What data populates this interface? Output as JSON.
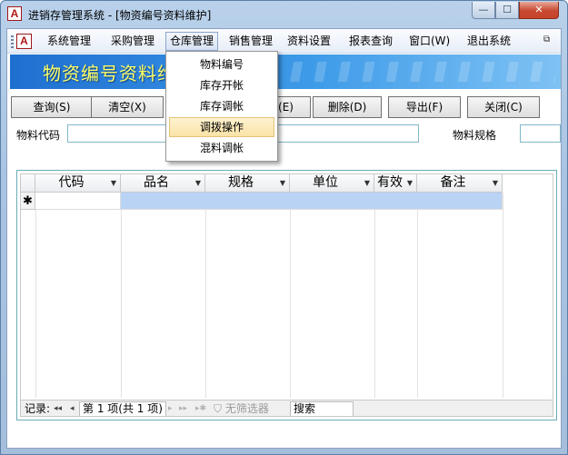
{
  "window": {
    "title": "进销存管理系统 - [物资编号资料维护]",
    "icon_letter": "A",
    "minimize_glyph": "—",
    "maximize_glyph": "☐",
    "close_glyph": "✕"
  },
  "menubar": {
    "icon_letter": "A",
    "items": [
      "系统管理",
      "采购管理",
      "仓库管理",
      "销售管理",
      "资料设置",
      "报表查询",
      "窗口(W)",
      "退出系统"
    ],
    "active_index": 2,
    "restore_glyph": "⧉"
  },
  "dropdown": {
    "items": [
      "物料编号",
      "库存开帐",
      "库存调帐",
      "调拨操作",
      "混料调帐"
    ],
    "hover_index": 3
  },
  "banner": {
    "title": "物资编号资料维护"
  },
  "toolbar": {
    "query": "查询(S)",
    "clear": "清空(X)",
    "hidden": "(E)",
    "delete": "删除(D)",
    "export": "导出(F)",
    "close": "关闭(C)"
  },
  "filters": {
    "code_label": "物料代码",
    "spec_label": "物料规格"
  },
  "grid": {
    "columns": [
      "代码",
      "品名",
      "规格",
      "单位",
      "有效",
      "备注"
    ],
    "new_row_marker": "✱"
  },
  "navigator": {
    "record_label": "记录:",
    "position": "第 1 项(共 1 项)",
    "filter_label": "无筛选器",
    "search_label": "搜索",
    "first_glyph": "◂◂",
    "prev_glyph": "◂",
    "next_glyph": "▸",
    "last_glyph": "▸▸",
    "new_glyph": "▸✱"
  },
  "colors": {
    "banner_start": "#1f6fd0",
    "banner_text": "#ffff66",
    "selected_row": "#b9d3f5",
    "grid_frame": "#6aaeb6"
  }
}
